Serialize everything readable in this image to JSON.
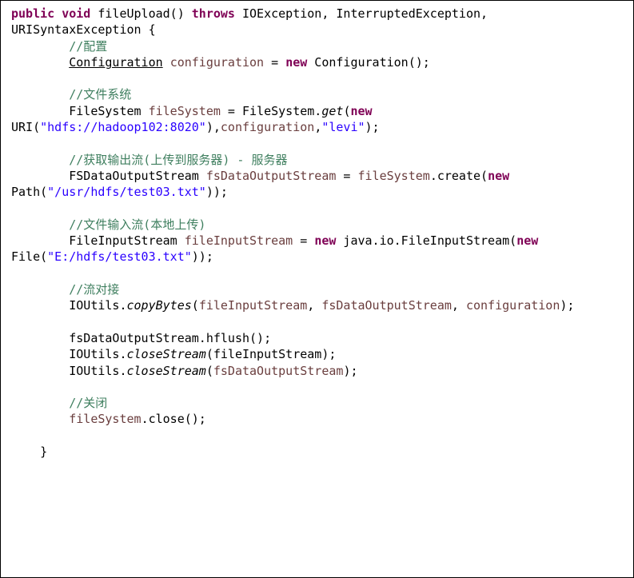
{
  "code": {
    "lines": [
      [
        {
          "t": "public",
          "c": "kw"
        },
        {
          "t": " "
        },
        {
          "t": "void",
          "c": "kw"
        },
        {
          "t": " fileUpload() "
        },
        {
          "t": "throws",
          "c": "kw"
        },
        {
          "t": " IOException, InterruptedException,"
        }
      ],
      [
        {
          "t": "URISyntaxException {"
        }
      ],
      [
        {
          "t": "        "
        },
        {
          "t": "//配置",
          "c": "cm"
        }
      ],
      [
        {
          "t": "        "
        },
        {
          "t": "Configuration",
          "c": "ul"
        },
        {
          "t": " "
        },
        {
          "t": "configuration",
          "c": "fld"
        },
        {
          "t": " = "
        },
        {
          "t": "new",
          "c": "kw"
        },
        {
          "t": " Configuration();"
        }
      ],
      [
        {
          "t": ""
        }
      ],
      [
        {
          "t": "        "
        },
        {
          "t": "//文件系统",
          "c": "cm"
        }
      ],
      [
        {
          "t": "        FileSystem "
        },
        {
          "t": "fileSystem",
          "c": "fld"
        },
        {
          "t": " = FileSystem."
        },
        {
          "t": "get",
          "c": "it"
        },
        {
          "t": "("
        },
        {
          "t": "new",
          "c": "kw"
        }
      ],
      [
        {
          "t": "URI("
        },
        {
          "t": "\"hdfs://hadoop102:8020\"",
          "c": "str"
        },
        {
          "t": "),"
        },
        {
          "t": "configuration",
          "c": "fld"
        },
        {
          "t": ","
        },
        {
          "t": "\"levi\"",
          "c": "str"
        },
        {
          "t": ");"
        }
      ],
      [
        {
          "t": ""
        }
      ],
      [
        {
          "t": "        "
        },
        {
          "t": "//获取输出流(上传到服务器) - 服务器",
          "c": "cm"
        }
      ],
      [
        {
          "t": "        FSDataOutputStream "
        },
        {
          "t": "fsDataOutputStream",
          "c": "fld"
        },
        {
          "t": " = "
        },
        {
          "t": "fileSystem",
          "c": "fld"
        },
        {
          "t": ".create("
        },
        {
          "t": "new",
          "c": "kw"
        }
      ],
      [
        {
          "t": "Path("
        },
        {
          "t": "\"/usr/hdfs/test03.txt\"",
          "c": "str"
        },
        {
          "t": "));"
        }
      ],
      [
        {
          "t": ""
        }
      ],
      [
        {
          "t": "        "
        },
        {
          "t": "//文件输入流(本地上传)",
          "c": "cm"
        }
      ],
      [
        {
          "t": "        FileInputStream "
        },
        {
          "t": "fileInputStream",
          "c": "fld"
        },
        {
          "t": " = "
        },
        {
          "t": "new",
          "c": "kw"
        },
        {
          "t": " java.io.FileInputStream("
        },
        {
          "t": "new",
          "c": "kw"
        }
      ],
      [
        {
          "t": "File("
        },
        {
          "t": "\"E:/hdfs/test03.txt\"",
          "c": "str"
        },
        {
          "t": "));"
        }
      ],
      [
        {
          "t": ""
        }
      ],
      [
        {
          "t": "        "
        },
        {
          "t": "//流对接",
          "c": "cm"
        }
      ],
      [
        {
          "t": "        IOUtils."
        },
        {
          "t": "copyBytes",
          "c": "it"
        },
        {
          "t": "("
        },
        {
          "t": "fileInputStream",
          "c": "fld"
        },
        {
          "t": ", "
        },
        {
          "t": "fsDataOutputStream",
          "c": "fld"
        },
        {
          "t": ", "
        },
        {
          "t": "configuration",
          "c": "fld"
        },
        {
          "t": ");"
        }
      ],
      [
        {
          "t": ""
        }
      ],
      [
        {
          "t": "        fsDataOutputStream.hflush();"
        }
      ],
      [
        {
          "t": "        IOUtils."
        },
        {
          "t": "closeStream",
          "c": "it"
        },
        {
          "t": "(fileInputStream);"
        }
      ],
      [
        {
          "t": "        IOUtils."
        },
        {
          "t": "closeStream",
          "c": "it"
        },
        {
          "t": "("
        },
        {
          "t": "fsDataOutputStream",
          "c": "fld"
        },
        {
          "t": ");"
        }
      ],
      [
        {
          "t": ""
        }
      ],
      [
        {
          "t": "        "
        },
        {
          "t": "//关闭",
          "c": "cm"
        }
      ],
      [
        {
          "t": "        "
        },
        {
          "t": "fileSystem",
          "c": "fld"
        },
        {
          "t": ".close();"
        }
      ],
      [
        {
          "t": ""
        }
      ],
      [
        {
          "t": "    }"
        }
      ]
    ]
  },
  "colors": {
    "keyword": "#7f0055",
    "field": "#6a3e3e",
    "string": "#2a00ff",
    "comment": "#3f7f5f",
    "text": "#000000",
    "background": "#ffffff"
  }
}
